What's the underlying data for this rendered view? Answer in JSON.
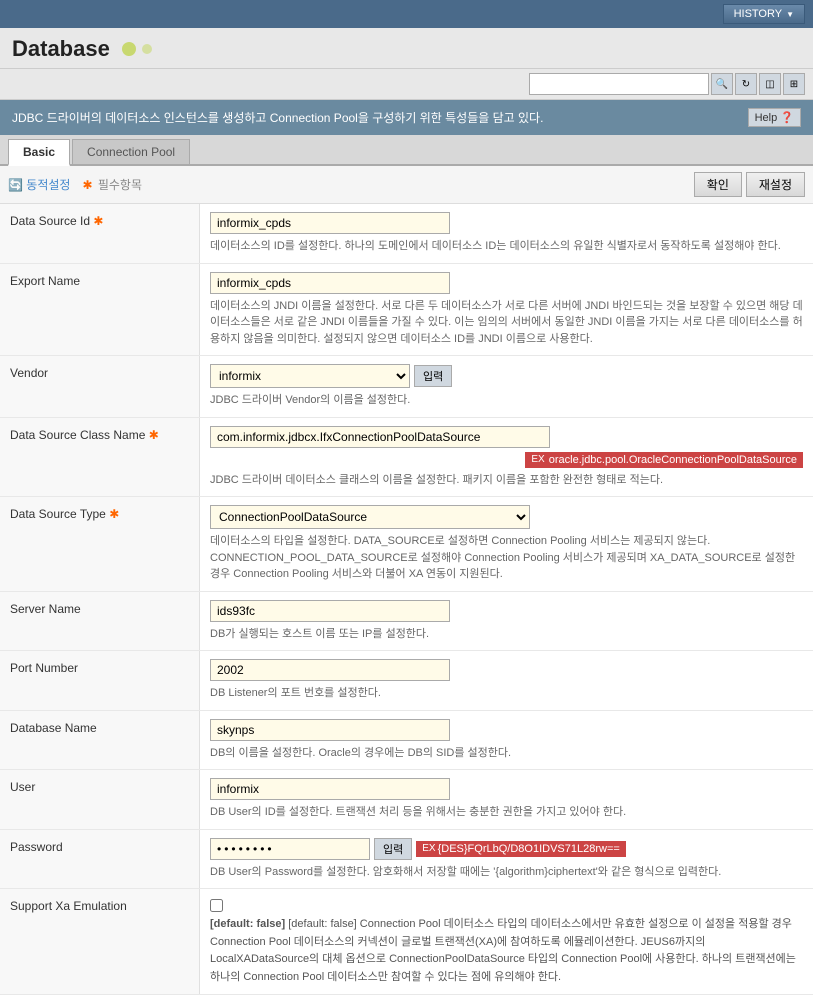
{
  "topBar": {
    "historyLabel": "HISTORY"
  },
  "header": {
    "title": "Database"
  },
  "infoBar": {
    "message": "JDBC 드라이버의 데이터소스 인스턴스를 생성하고 Connection Pool을 구성하기 위한 특성들을 담고 있다.",
    "helpLabel": "Help",
    "helpIcon": "?"
  },
  "tabs": [
    {
      "id": "basic",
      "label": "Basic",
      "active": true
    },
    {
      "id": "connection-pool",
      "label": "Connection Pool",
      "active": false
    }
  ],
  "formHeader": {
    "dynamicLabel": "동적설정",
    "requiredLabel": "필수항목",
    "confirmBtn": "확인",
    "resetBtn": "재설정"
  },
  "fields": {
    "dataSourceId": {
      "label": "Data Source Id",
      "required": true,
      "value": "informix_cpds",
      "description": "데이터소스의 ID를 설정한다. 하나의 도메인에서 데이터소스 ID는 데이터소스의 유일한 식별자로서 동작하도록 설정해야 한다."
    },
    "exportName": {
      "label": "Export Name",
      "required": false,
      "value": "informix_cpds",
      "description": "데이터소스의 JNDI 이름을 설정한다. 서로 다른 두 데이터소스가 서로 다른 서버에 JNDI 바인드되는 것을 보장할 수 있으면 해당 데이터소스들은 서로 같은 JNDI 이름들을 가질 수 있다. 이는 임의의 서버에서 동일한 JNDI 이름을 가지는 서로 다른 데이터소스를 허용하지 않음을 의미한다. 설정되지 않으면 데이터소스 ID를 JNDI 이름으로 사용한다."
    },
    "vendor": {
      "label": "Vendor",
      "required": false,
      "value": "informix",
      "options": [
        "informix"
      ],
      "inputBtnLabel": "입력",
      "description": "JDBC 드라이버 Vendor의 이름을 설정한다."
    },
    "dataSourceClassName": {
      "label": "Data Source Class Name",
      "required": true,
      "value": "com.informix.jdbcx.IfxConnectionPoolDataSource",
      "suggestion": "oracle.jdbc.pool.OracleConnectionPoolDataSource",
      "suggestionPrefix": "EX",
      "description": "JDBC 드라이버 데이터소스 클래스의 이름을 설정한다. 패키지 이름을 포함한 완전한 형태로 적는다."
    },
    "dataSourceType": {
      "label": "Data Source Type",
      "required": true,
      "value": "ConnectionPoolDataSource",
      "options": [
        "ConnectionPoolDataSource"
      ],
      "description": "데이터소스의 타입을 설정한다. DATA_SOURCE로 설정하면 Connection Pooling 서비스는 제공되지 않는다. CONNECTION_POOL_DATA_SOURCE로 설정해야 Connection Pooling 서비스가 제공되며 XA_DATA_SOURCE로 설정한 경우 Connection Pooling 서비스와 더불어 XA 연동이 지원된다."
    },
    "serverName": {
      "label": "Server Name",
      "required": false,
      "value": "ids93fc",
      "description": "DB가 실행되는 호스트 이름 또는 IP를 설정한다."
    },
    "portNumber": {
      "label": "Port Number",
      "required": false,
      "value": "2002",
      "description": "DB Listener의 포트 번호를 설정한다."
    },
    "databaseName": {
      "label": "Database Name",
      "required": false,
      "value": "skynps",
      "description": "DB의 이름을 설정한다. Oracle의 경우에는 DB의 SID를 설정한다."
    },
    "user": {
      "label": "User",
      "required": false,
      "value": "informix",
      "description": "DB User의 ID를 설정한다. 트랜잭션 처리 등을 위해서는 충분한 권한을 가지고 있어야 한다."
    },
    "password": {
      "label": "Password",
      "required": false,
      "maskedValue": "• • • • • • • •",
      "inputBtnLabel": "입력",
      "encryptedLabel": "EX",
      "encryptedValue": "{DES}FQrLbQ/D8O1IDVS71L28rw==",
      "description": "DB User의 Password를 설정한다. 암호화해서 저장할 때에는 '{algorithm}ciphertext'와 같은 형식으로 입력한다."
    },
    "supportXaEmulation": {
      "label": "Support Xa Emulation",
      "required": false,
      "checked": false,
      "description": "[default: false]  Connection Pool 데이터소스 타입의 데이터소스에서만 유효한 설정으로 이 설정을 적용할 경우 Connection Pool 데이터소스의 커넥션이 글로벌 트랜잭션(XA)에 참여하도록 에뮬레이션한다. JEUS6까지의 LocalXADataSource의 대체 옵션으로 ConnectionPoolDataSource 타입의 Connection Pool에 사용한다. 하나의 트랜잭션에는 하나의 Connection Pool 데이터소스만 참여할 수 있다는 점에 유의해야 한다."
    }
  }
}
